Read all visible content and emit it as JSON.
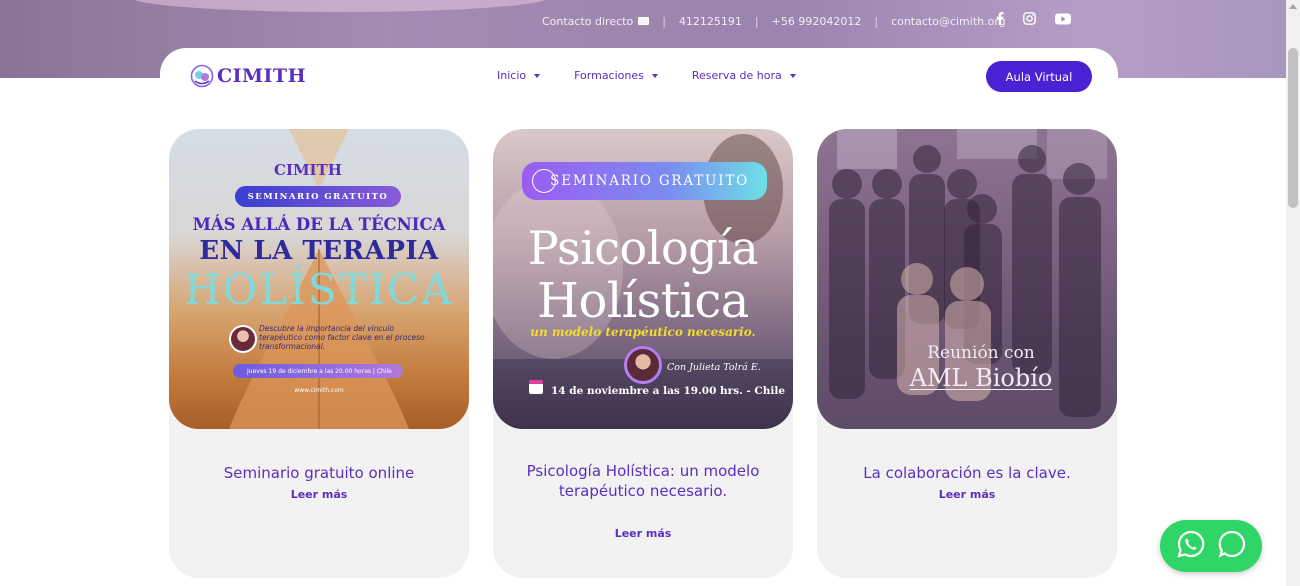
{
  "topbar": {
    "contact_label": "Contacto directo",
    "phone1": "412125191",
    "phone2": "+56 992042012",
    "email": "contacto@cimith.org",
    "separator": "|",
    "social": [
      "facebook-icon",
      "instagram-icon",
      "youtube-icon"
    ]
  },
  "brand": {
    "name": "CIMITH",
    "color": "#5a2fbf"
  },
  "nav": {
    "items": [
      {
        "label": "Inicio"
      },
      {
        "label": "Formaciones"
      },
      {
        "label": "Reserva de hora"
      }
    ],
    "cta_label": "Aula Virtual",
    "cta_color": "#4a22d4"
  },
  "cards": [
    {
      "title": "Seminario gratuito online",
      "read_more": "Leer más",
      "image": {
        "logo": "CIMITH",
        "badge": "SEMINARIO GRATUITO",
        "line1": "MÁS ALLÁ DE LA TÉCNICA",
        "line2": "EN LA TERAPIA",
        "line3": "HOLÍSTICA",
        "desc": "Descubre la importancia del vínculo terapéutico como factor clave en el proceso transformacional.",
        "date": "Jueves 19 de diciembre a las 20.00 horas | Chile",
        "url": "www.cimith.com"
      }
    },
    {
      "title": "Psicología Holística: un modelo terapéutico necesario.",
      "read_more": "Leer más",
      "image": {
        "badge": "SEMINARIO GRATUITO",
        "line1": "Psicología",
        "line2": "Holística",
        "subtitle": "un modelo terapéutico necesario.",
        "speaker": "Con Julieta Tolrá E.",
        "date": "14 de noviembre a las 19.00 hrs. - Chile"
      }
    },
    {
      "title": "La colaboración es la clave.",
      "read_more": "Leer más",
      "image": {
        "line1": "Reunión con",
        "line2": "AML Biobío"
      }
    }
  ],
  "whatsapp": {
    "icons": [
      "whatsapp-icon",
      "chat-bubble-icon"
    ],
    "color": "#2fd566"
  }
}
